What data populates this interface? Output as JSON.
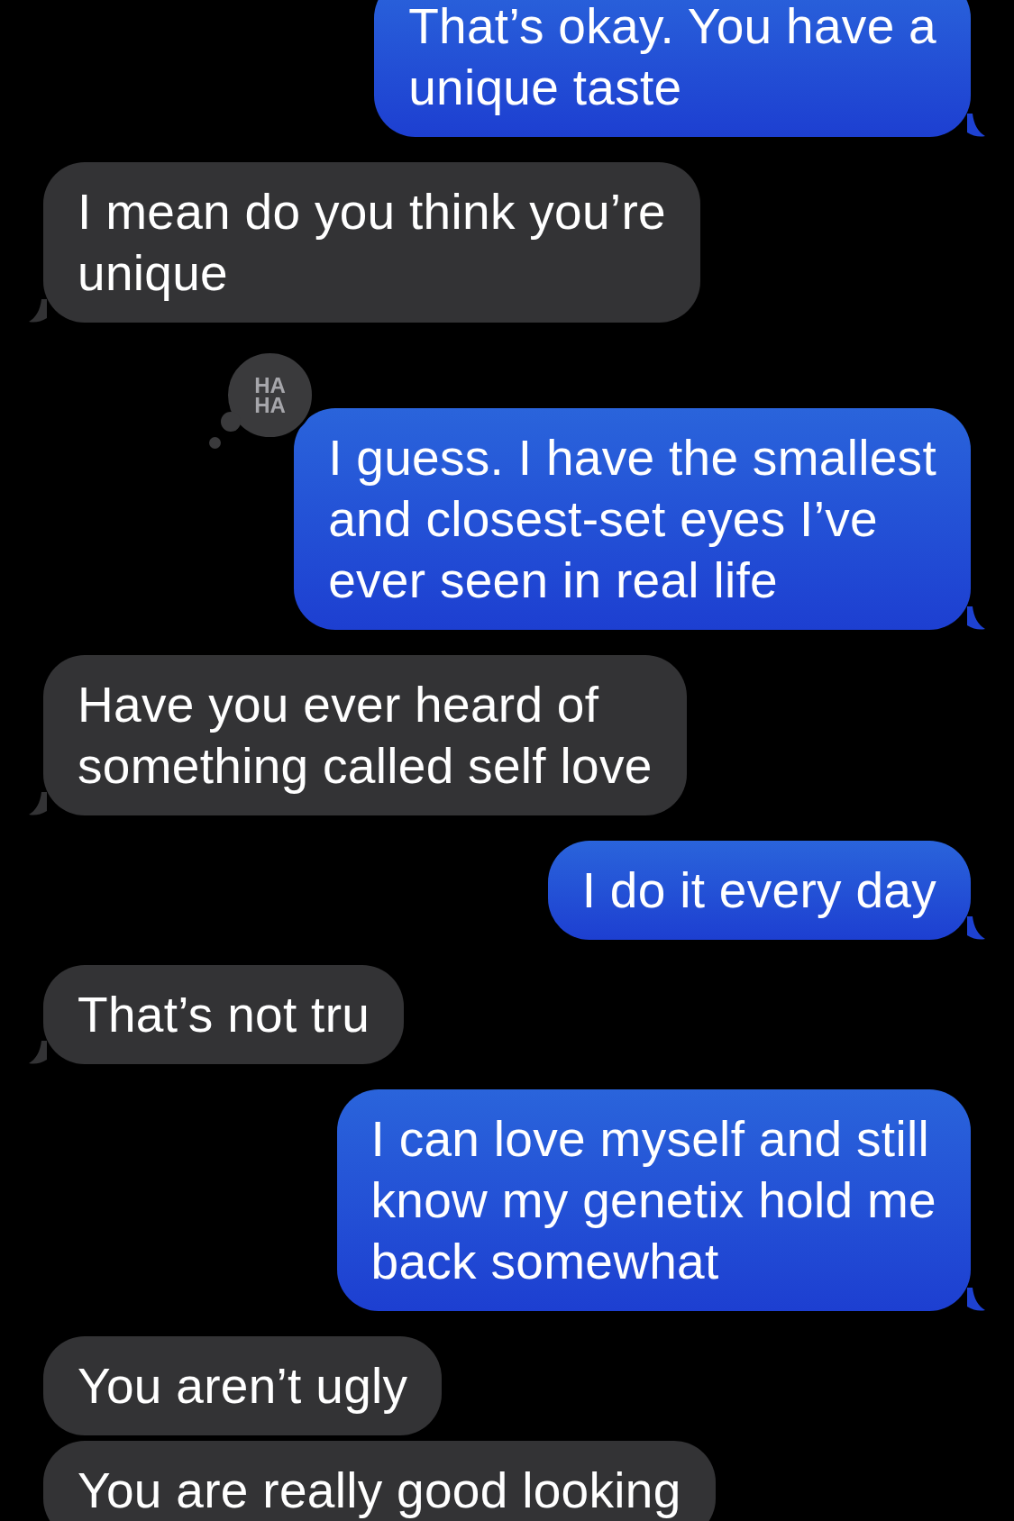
{
  "messages": [
    {
      "kind": "out",
      "text": "That’s okay. You have a\nunique taste"
    },
    {
      "kind": "in",
      "text": "I mean do you think you’re\nunique"
    },
    {
      "kind": "out",
      "text": "I guess. I have the smallest\nand closest-set eyes I’ve\never seen in real life",
      "reaction": {
        "kind": "haha",
        "lines": [
          "HA",
          "HA"
        ]
      }
    },
    {
      "kind": "in",
      "text": "Have you ever heard of\nsomething called self love"
    },
    {
      "kind": "out",
      "text": "I do it every day"
    },
    {
      "kind": "in",
      "text": "That’s not tru"
    },
    {
      "kind": "out",
      "text": "I can love myself and still\nknow my genetix hold me\nback somewhat"
    },
    {
      "kind": "in",
      "text": "You aren’t ugly"
    },
    {
      "kind": "in",
      "text": "You are really good looking"
    }
  ]
}
